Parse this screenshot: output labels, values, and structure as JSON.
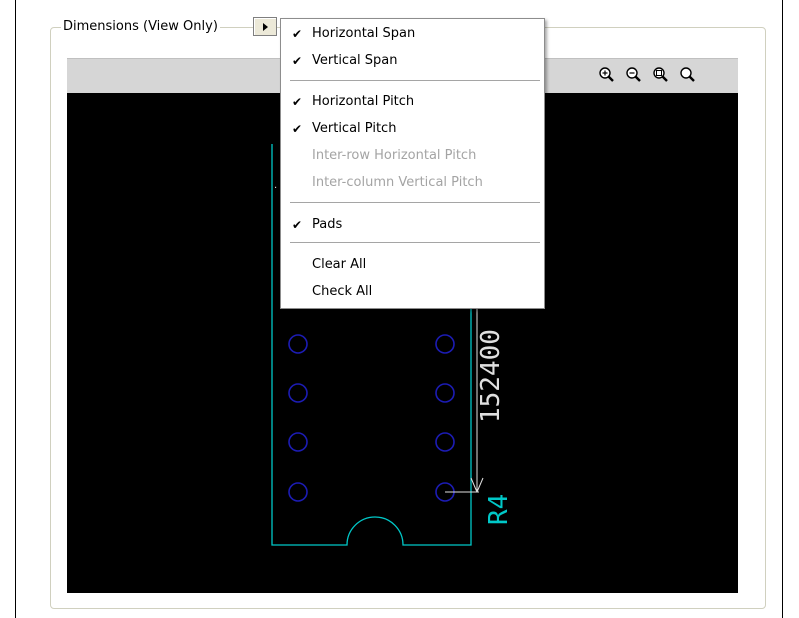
{
  "group": {
    "title": "Dimensions (View Only)"
  },
  "menu": {
    "items": [
      {
        "label": "Horizontal Span",
        "checked": "✔",
        "enabled": true
      },
      {
        "label": "Vertical Span",
        "checked": "✔",
        "enabled": true
      },
      {
        "label": "Horizontal Pitch",
        "checked": "✔",
        "enabled": true
      },
      {
        "label": "Vertical Pitch",
        "checked": "✔",
        "enabled": true
      },
      {
        "label": "Inter-row Horizontal Pitch",
        "checked": "",
        "enabled": false
      },
      {
        "label": "Inter-column Vertical Pitch",
        "checked": "",
        "enabled": false
      },
      {
        "label": "Pads",
        "checked": "✔",
        "enabled": true
      },
      {
        "label": "Clear All",
        "checked": "",
        "enabled": true
      },
      {
        "label": "Check All",
        "checked": "",
        "enabled": true
      }
    ]
  },
  "toolbar": {
    "icons": [
      "zoom-in-icon",
      "zoom-out-icon",
      "zoom-fit-icon",
      "zoom-icon"
    ]
  },
  "canvas": {
    "dimension_text": "152400",
    "label_text": "R4",
    "colors": {
      "outline": "#00c8c8",
      "pads": "#1c1cb4",
      "dimension": "#e0e0e0",
      "background": "#000000"
    }
  }
}
